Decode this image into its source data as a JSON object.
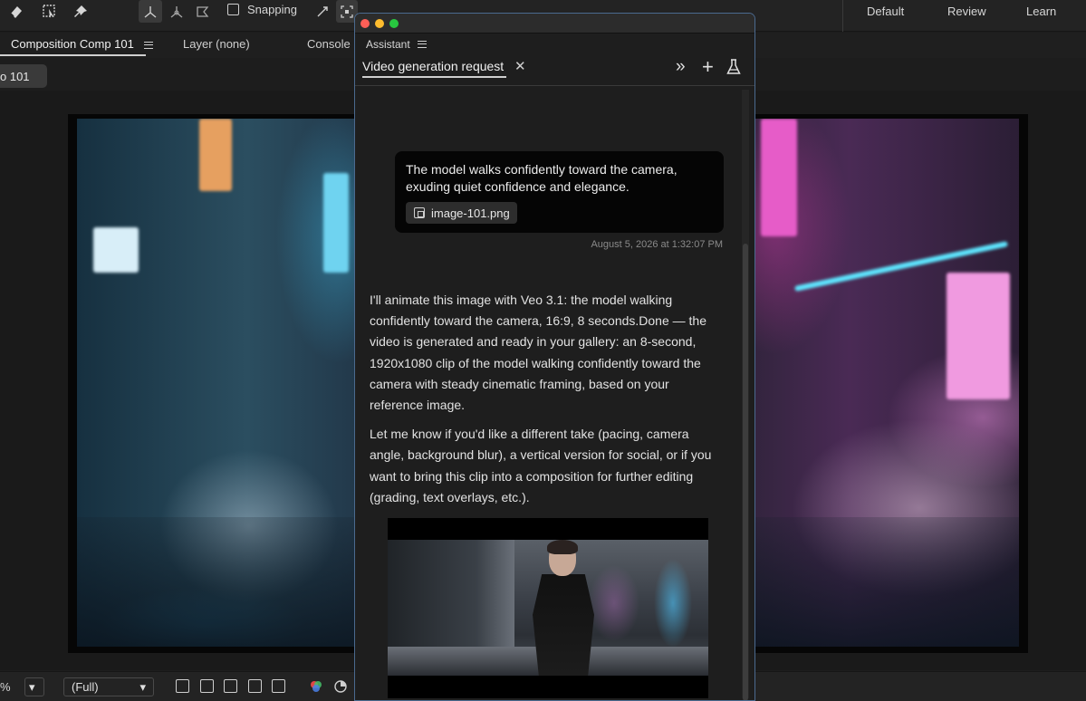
{
  "toolbar": {
    "snapping_label": "Snapping",
    "workspaces": [
      "Default",
      "Review",
      "Learn"
    ]
  },
  "tabs": {
    "composition": "Composition Comp 101",
    "layer": "Layer (none)",
    "console": "Console"
  },
  "breadcrumb": "o 101",
  "bottom": {
    "zoom_suffix": "%",
    "resolution": "(Full)"
  },
  "assistant": {
    "panel_title": "Assistant",
    "tab_title": "Video generation request",
    "user_message": "The model walks confidently toward the camera, exuding quiet confidence and elegance.",
    "attachment_name": "image-101.png",
    "timestamp": "August 5, 2026 at 1:32:07 PM",
    "reply_paragraph_1": "I'll animate this image with Veo 3.1: the model walking confidently toward the camera, 16:9, 8 seconds.Done — the video is generated and ready in your gallery: an 8-second, 1920x1080 clip of the model walking confidently toward the camera with steady cinematic framing, based on your reference image.",
    "reply_paragraph_2": "Let me know if you'd like a different take (pacing, camera angle, background blur), a vertical version for social, or if you want to bring this clip into a composition for further editing (grading, text overlays, etc.)."
  },
  "colors": {
    "panel_border": "#4b6a8f",
    "traffic_red": "#ff5f57",
    "traffic_yellow": "#febc2e",
    "traffic_green": "#28c840"
  }
}
